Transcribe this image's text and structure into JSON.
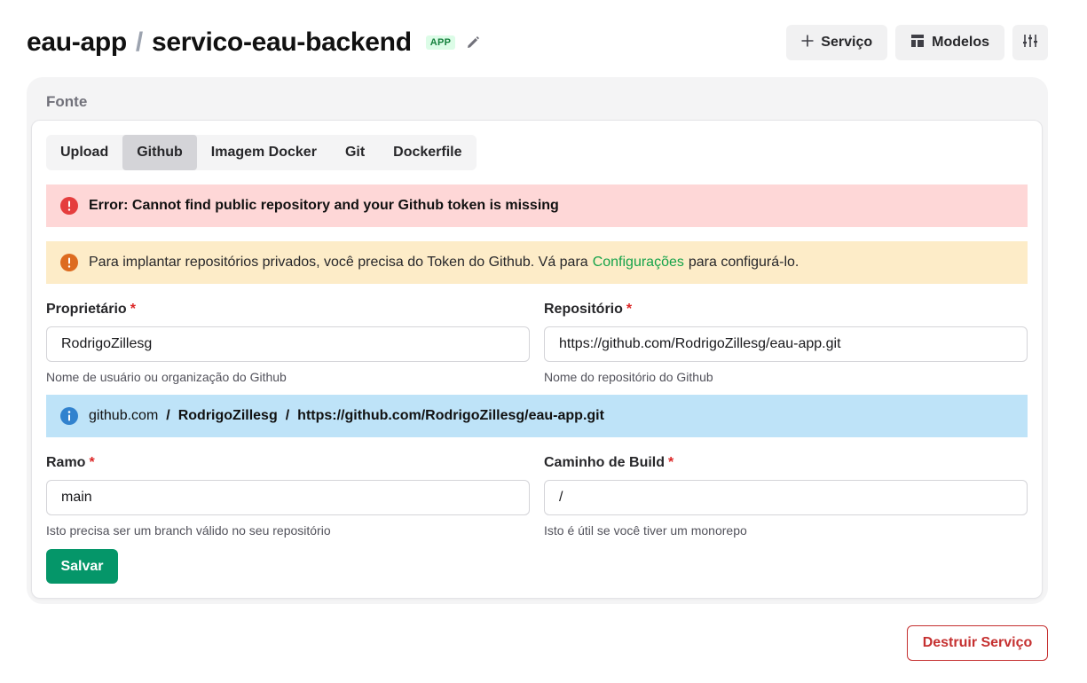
{
  "header": {
    "project": "eau-app",
    "separator": "/",
    "service": "servico-eau-backend",
    "badge": "APP",
    "actions": {
      "service_label": "Serviço",
      "models_label": "Modelos"
    }
  },
  "source": {
    "title": "Fonte",
    "tabs": [
      {
        "label": "Upload",
        "active": false
      },
      {
        "label": "Github",
        "active": true
      },
      {
        "label": "Imagem Docker",
        "active": false
      },
      {
        "label": "Git",
        "active": false
      },
      {
        "label": "Dockerfile",
        "active": false
      }
    ],
    "error_text": "Error: Cannot find public repository and your Github token is missing",
    "warning": {
      "prefix": "Para implantar repositórios privados, você precisa do Token do Github. Vá para",
      "link": "Configurações",
      "suffix": "para configurá-lo."
    },
    "owner": {
      "label": "Proprietário",
      "required": "*",
      "value": "RodrigoZillesg",
      "help": "Nome de usuário ou organização do Github"
    },
    "repository": {
      "label": "Repositório",
      "required": "*",
      "value": "https://github.com/RodrigoZillesg/eau-app.git",
      "help": "Nome do repositório do Github"
    },
    "info": {
      "host": "github.com",
      "sep": "/",
      "owner": "RodrigoZillesg",
      "repo": "https://github.com/RodrigoZillesg/eau-app.git"
    },
    "branch": {
      "label": "Ramo",
      "required": "*",
      "value": "main",
      "help": "Isto precisa ser um branch válido no seu repositório"
    },
    "build_path": {
      "label": "Caminho de Build",
      "required": "*",
      "value": "/",
      "help": "Isto é útil se você tiver um monorepo"
    },
    "save_label": "Salvar"
  },
  "destroy_label": "Destruir Serviço",
  "colors": {
    "save": "#059669",
    "destroy": "#c53030",
    "error_bg": "#fed7d7",
    "warning_bg": "#fdecc8",
    "info_bg": "#bee3f8",
    "link": "#16a34a"
  },
  "icons": {
    "edit": "pencil-icon",
    "add": "plus-icon",
    "models": "layout-icon",
    "settings": "sliders-icon",
    "error": "error-circle-icon",
    "warning": "warning-circle-icon",
    "info": "info-circle-icon"
  }
}
